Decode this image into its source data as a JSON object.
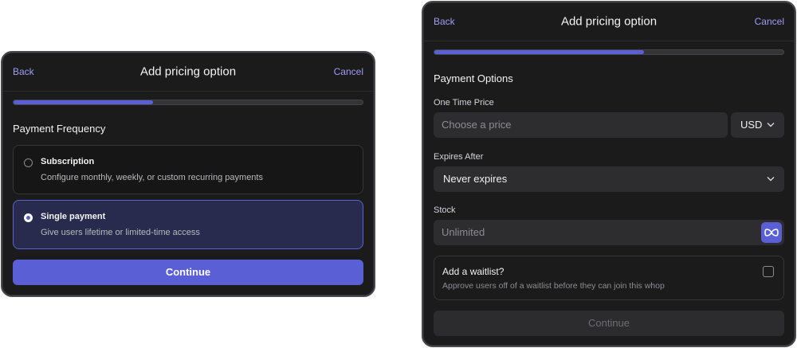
{
  "left_panel": {
    "back_label": "Back",
    "title": "Add pricing option",
    "cancel_label": "Cancel",
    "progress": 0.4,
    "section_title": "Payment Frequency",
    "options": [
      {
        "title": "Subscription",
        "description": "Configure monthly, weekly, or custom recurring payments",
        "selected": false
      },
      {
        "title": "Single payment",
        "description": "Give users lifetime or limited-time access",
        "selected": true
      }
    ],
    "continue_label": "Continue"
  },
  "right_panel": {
    "back_label": "Back",
    "title": "Add pricing option",
    "cancel_label": "Cancel",
    "progress": 0.6,
    "section_title": "Payment Options",
    "one_time_price": {
      "label": "One Time Price",
      "placeholder": "Choose a price",
      "currency": "USD"
    },
    "expires_after": {
      "label": "Expires After",
      "value": "Never expires"
    },
    "stock": {
      "label": "Stock",
      "placeholder": "Unlimited"
    },
    "waitlist": {
      "title": "Add a waitlist?",
      "description": "Approve users off of a waitlist before they can join this whop",
      "checked": false
    },
    "continue_label": "Continue"
  },
  "colors": {
    "accent": "#5a5fd6",
    "link": "#9f9cf4",
    "panel_bg": "#1b1b1c",
    "selected_bg": "#282b4d"
  },
  "icons": [
    "chevron-down-icon",
    "infinity-icon",
    "radio-icon",
    "checkbox-icon"
  ]
}
